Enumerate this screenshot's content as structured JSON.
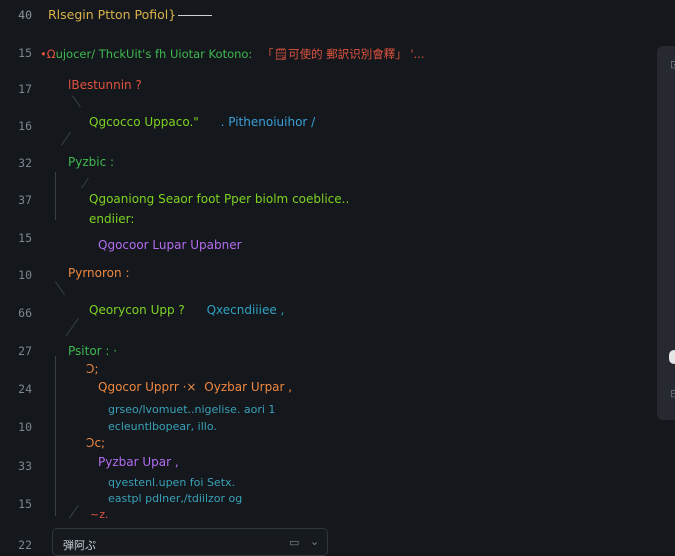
{
  "gutter": {
    "line_numbers": [
      "40",
      "15",
      "17",
      "16",
      "32",
      "37",
      "15",
      "10",
      "66",
      "27",
      "24",
      "10",
      "33",
      "15",
      "22"
    ]
  },
  "header": {
    "title": "Rlsegin Ptton Pofiol}"
  },
  "lines": {
    "l1_prefix": "•Ω",
    "l1_main": "ujocer/ ThckUit's fh Uiotar Kotono:",
    "l1_cjk": "「🗒可使的 郵訳识別會釋」",
    "l1_tail": "'...",
    "l2": "lBestunnin ?",
    "l3_a": "Qgcocco Uppaco.\"",
    "l3_b": ". Pithenoiuihor /",
    "l4": "Pyzbic :",
    "l5": "Qgoaniong Seaor foot Pper biolm coeblice..",
    "l6": "endiier:",
    "l7": "Qgocoor Lupar Upabner",
    "l8": "Pyrnoron :",
    "l9_a": "Qeorycon Upp ?",
    "l9_b": "Qxecndiiiee ,",
    "l10": "Psitor : ·",
    "l11": "Ɔ;",
    "l12_a": "Qgocor Upprr ·×",
    "l12_b": "Oyzbar Urpar ,",
    "l13": "grseo/lvomuet..nigelise. aori 1",
    "l14": "ecleuntlbopear, illo.",
    "l15": "Ɔc;",
    "l16": "Pyzbar Upar ,",
    "l17": "qyestenl.upen foi Setx.",
    "l18": "eastpl pdlner,/tdiilzor og",
    "l19": "~z."
  },
  "bottombar": {
    "label": "弾阿ぷ",
    "icon1": "square-icon",
    "icon2": "chevron-down-icon"
  },
  "minimap": {
    "glyph_top": "⊡",
    "glyph_bottom": "⊟"
  },
  "colors": {
    "background": "#14171c",
    "line_number": "#7d8590",
    "yellow": "#d9b24a",
    "green": "#7ed321",
    "red": "#e0533f",
    "orange": "#f0883e",
    "blue": "#39a0d8",
    "purple": "#b26cf0"
  }
}
